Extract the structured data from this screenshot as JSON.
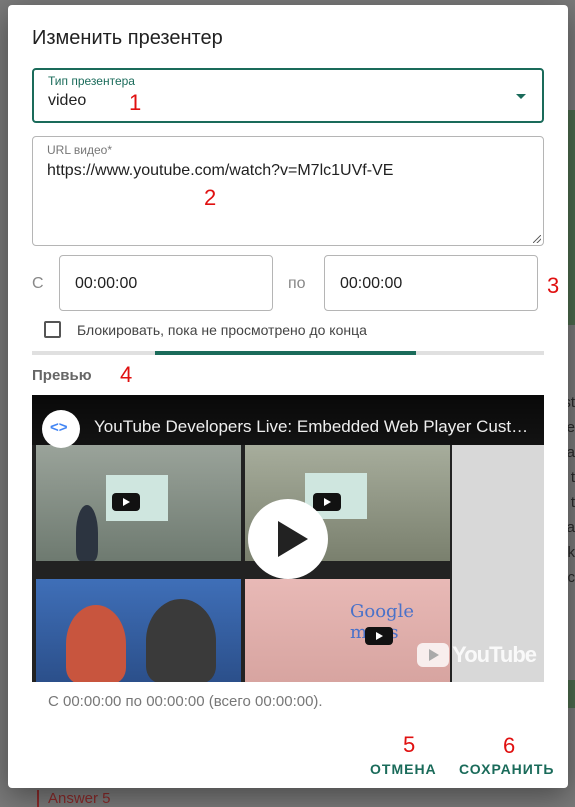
{
  "background": {
    "answer_text": "Answer 5",
    "right_text": [
      "st",
      "e",
      "a",
      "t",
      "t",
      "a",
      "k",
      "oc"
    ]
  },
  "dialog": {
    "title": "Изменить презентер",
    "type_field": {
      "label": "Тип презентера",
      "value": "video"
    },
    "url_field": {
      "label": "URL видео*",
      "value": "https://www.youtube.com/watch?v=M7lc1UVf-VE"
    },
    "time": {
      "from_label": "С",
      "to_label": "по",
      "start_value": "00:00:00",
      "end_value": "00:00:00"
    },
    "checkbox": {
      "label": "Блокировать, пока не просмотрено до конца",
      "checked": false
    },
    "progress": {
      "start_fraction": 0.24,
      "end_fraction": 0.75
    },
    "preview": {
      "label": "Превью",
      "video_title": "YouTube Developers Live: Embedded Web Player Customization",
      "maps_text": "Google maps",
      "yt_logo_text": "YouTube"
    },
    "range_summary": "С 00:00:00 по 00:00:00 (всего 00:00:00).",
    "buttons": {
      "cancel": "ОТМЕНА",
      "save": "СОХРАНИТЬ"
    }
  },
  "annotations": [
    "1",
    "2",
    "3",
    "4",
    "5",
    "6"
  ],
  "colors": {
    "accent": "#1a6b5a",
    "annotation": "#e01010"
  }
}
